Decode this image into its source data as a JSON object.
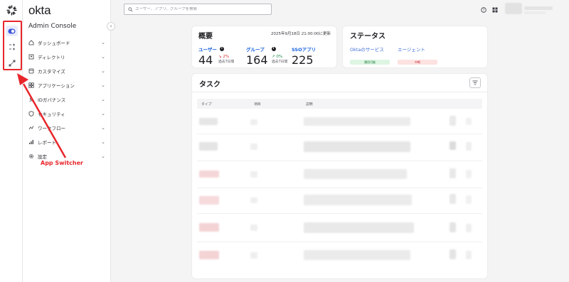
{
  "app": {
    "brand": "okta",
    "console_title": "Admin Console"
  },
  "search": {
    "placeholder": "ユーザー、アプリ、グループを検索"
  },
  "sidebar": {
    "items": [
      {
        "label": "ダッシュボード",
        "icon": "home-icon"
      },
      {
        "label": "ディレクトリ",
        "icon": "directory-icon"
      },
      {
        "label": "カスタマイズ",
        "icon": "customize-icon"
      },
      {
        "label": "アプリケーション",
        "icon": "applications-icon"
      },
      {
        "label": "IDガバナンス",
        "icon": "governance-icon"
      },
      {
        "label": "セキュリティ",
        "icon": "shield-icon"
      },
      {
        "label": "ワークフロー",
        "icon": "workflow-icon"
      },
      {
        "label": "レポート",
        "icon": "reports-icon"
      },
      {
        "label": "設定",
        "icon": "gear-icon"
      }
    ]
  },
  "overview": {
    "title": "概要",
    "updated": "2025年9月18日 21:00:00に更新",
    "metrics": [
      {
        "label": "ユーザー",
        "value": "44",
        "trend": "↘ 2%",
        "trend_sub": "過去7日間",
        "trend_color": "#d22d2d"
      },
      {
        "label": "グループ",
        "value": "164",
        "trend": "↗ 0%",
        "trend_sub": "過去7日間",
        "trend_color": "#1a8a4a"
      },
      {
        "label": "SSOアプリ",
        "value": "225"
      }
    ]
  },
  "status": {
    "title": "ステータス",
    "rows": [
      {
        "label": "Oktaのサービス",
        "pill": "運用可能",
        "pill_bg": "#dff5e4",
        "pill_color": "#1a7a3a"
      },
      {
        "label": "エージェント",
        "pill": "中断",
        "pill_bg": "#fde2e2",
        "pill_color": "#c0282b"
      }
    ]
  },
  "tasks": {
    "title": "タスク",
    "columns": [
      "タイプ",
      "項目",
      "説明"
    ]
  },
  "annotation": {
    "label": "App Switcher",
    "color": "#e8262a"
  }
}
